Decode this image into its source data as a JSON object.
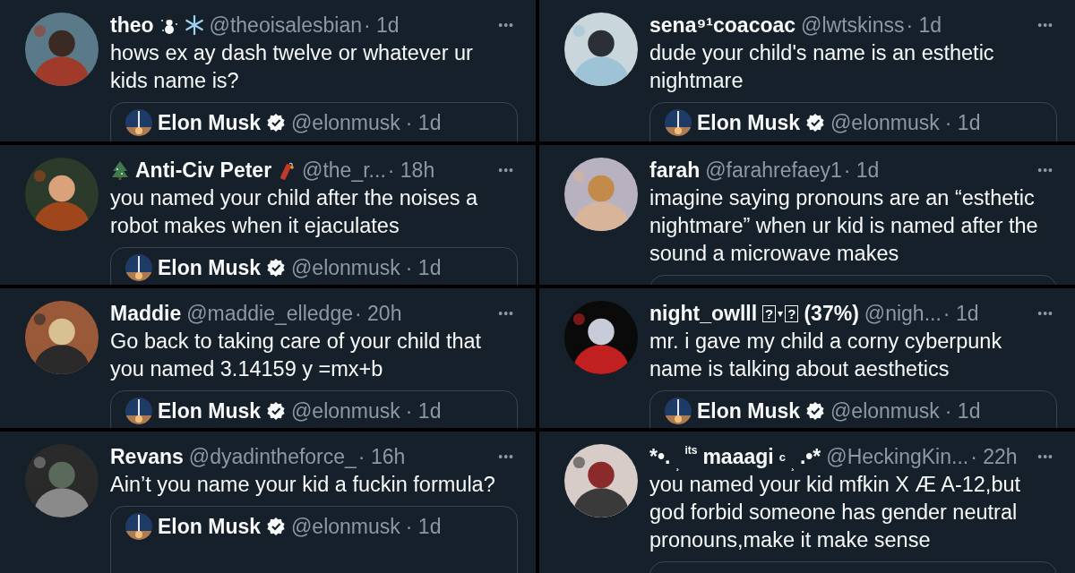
{
  "posts": [
    {
      "avatar": {
        "kind": "picture"
      },
      "name": [
        {
          "kind": "text",
          "text": "theo"
        },
        {
          "kind": "snowman"
        },
        {
          "kind": "snowflake"
        }
      ],
      "handle": "@theoisalesbian",
      "time": "· 1d",
      "more": "•••",
      "text": "hows ex ay dash twelve or whatever ur kids name is?",
      "quote": {
        "kind": "post",
        "name": "Elon Musk",
        "verified": true,
        "handle": "@elonmusk",
        "time": "· 1d"
      }
    },
    {
      "avatar": {
        "kind": "picture"
      },
      "name": [
        {
          "kind": "text",
          "text": "sena⁹¹coacoac"
        }
      ],
      "handle": "@lwtskinss",
      "time": "· 1d",
      "more": "•••",
      "text": "dude your child's name is an  esthetic nightmare",
      "quote": {
        "kind": "post",
        "name": "Elon Musk",
        "verified": true,
        "handle": "@elonmusk",
        "time": "· 1d"
      }
    },
    {
      "avatar": {
        "kind": "picture"
      },
      "name": [
        {
          "kind": "tree"
        },
        {
          "kind": "text",
          "text": "Anti-Civ Peter"
        },
        {
          "kind": "firecracker"
        }
      ],
      "handle": "@the_r...",
      "time": "· 18h",
      "more": "•••",
      "text": "you named your child after the noises a robot makes when it ejaculates",
      "quote": {
        "kind": "post",
        "name": "Elon Musk",
        "verified": true,
        "handle": "@elonmusk",
        "time": "· 1d"
      }
    },
    {
      "avatar": {
        "kind": "picture"
      },
      "name": [
        {
          "kind": "text",
          "text": "farah"
        }
      ],
      "handle": "@farahrefaey1",
      "time": "· 1d",
      "more": "•••",
      "text": "imagine saying pronouns are an “esthetic nightmare” when ur kid is named after the sound a microwave makes",
      "quote": {
        "kind": "card"
      }
    },
    {
      "avatar": {
        "kind": "picture"
      },
      "name": [
        {
          "kind": "text",
          "text": "Maddie"
        }
      ],
      "handle": "@maddie_elledge",
      "time": "· 20h",
      "more": "•••",
      "text": "Go back to taking care of your child that you named 3.14159 y =mx+b",
      "quote": {
        "kind": "post",
        "name": "Elon Musk",
        "verified": true,
        "handle": "@elonmusk",
        "time": "· 1d"
      }
    },
    {
      "avatar": {
        "kind": "picture"
      },
      "name": [
        {
          "kind": "text",
          "text": "night_owlll"
        },
        {
          "kind": "boxed",
          "text": "?"
        },
        {
          "kind": "caret",
          "text": "▾"
        },
        {
          "kind": "boxed",
          "text": "?"
        },
        {
          "kind": "text",
          "text": "(37%)"
        }
      ],
      "handle": "@nigh...",
      "time": "· 1d",
      "more": "•••",
      "text": "mr. i gave my child a corny cyberpunk name is talking about aesthetics",
      "quote": {
        "kind": "post",
        "name": "Elon Musk",
        "verified": true,
        "handle": "@elonmusk",
        "time": "· 1d"
      }
    },
    {
      "avatar": {
        "kind": "picture"
      },
      "name": [
        {
          "kind": "text",
          "text": "Revans"
        }
      ],
      "handle": "@dyadintheforce_",
      "time": "· 16h",
      "more": "•••",
      "text": "Ain’t you name your kid a fuckin formula?",
      "quote": {
        "kind": "post",
        "name": "Elon Musk",
        "verified": true,
        "handle": "@elonmusk",
        "time": "· 1d"
      }
    },
    {
      "avatar": {
        "kind": "picture"
      },
      "name": [
        {
          "kind": "text",
          "text": "*•."
        },
        {
          "kind": "sub",
          "text": "¸"
        },
        {
          "kind": "sup",
          "text": "its"
        },
        {
          "kind": "text",
          "text": "maaagi"
        },
        {
          "kind": "small",
          "text": "c"
        },
        {
          "kind": "sub",
          "text": "¸"
        },
        {
          "kind": "text",
          "text": ".•*"
        }
      ],
      "handle": "@HeckingKin...",
      "time": "· 22h",
      "more": "•••",
      "text": "you named your kid mfkin X Æ A-12,but god forbid someone has gender neutral pronouns,make it make sense",
      "quote": {
        "kind": "card"
      }
    }
  ]
}
